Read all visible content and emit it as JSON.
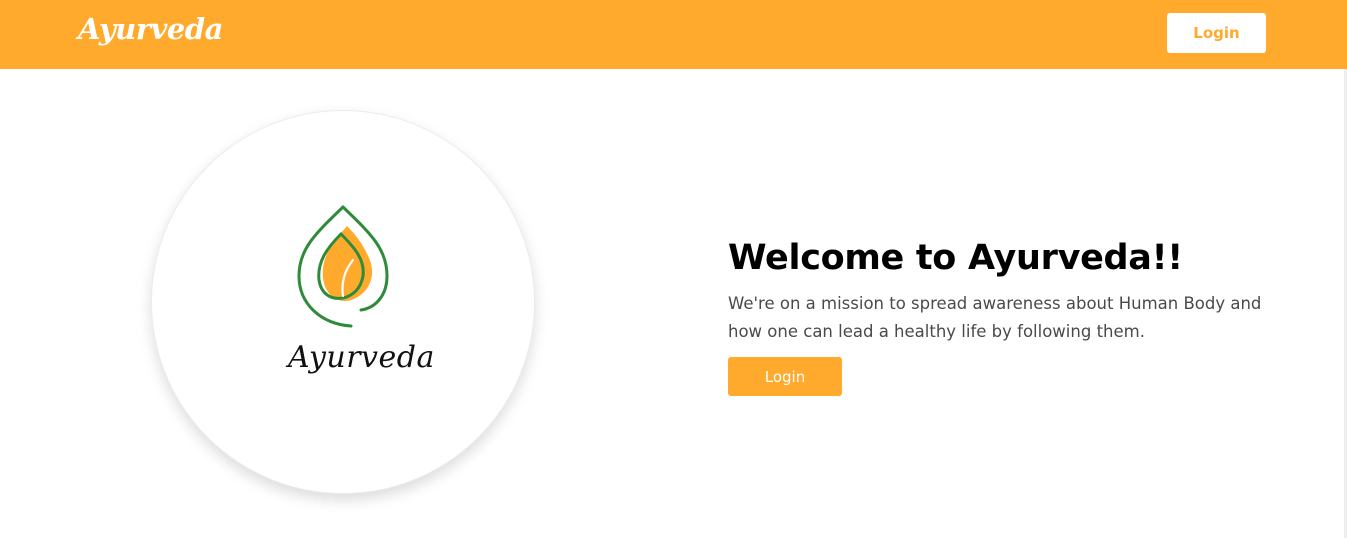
{
  "navbar": {
    "brand": "Ayurveda",
    "login_label": "Login"
  },
  "hero": {
    "logo_text": "Ayurveda",
    "title": "Welcome to Ayurveda!!",
    "description": "We're on a mission to spread awareness about Human Body and how one can lead a healthy life by following them.",
    "login_label": "Login"
  },
  "colors": {
    "brand_orange": "#ffaa2c",
    "leaf_green": "#2e8b3a",
    "text_dark": "#000000",
    "text_body": "#4a4a4a"
  },
  "icons": {
    "logo": "drop-leaf-icon"
  }
}
